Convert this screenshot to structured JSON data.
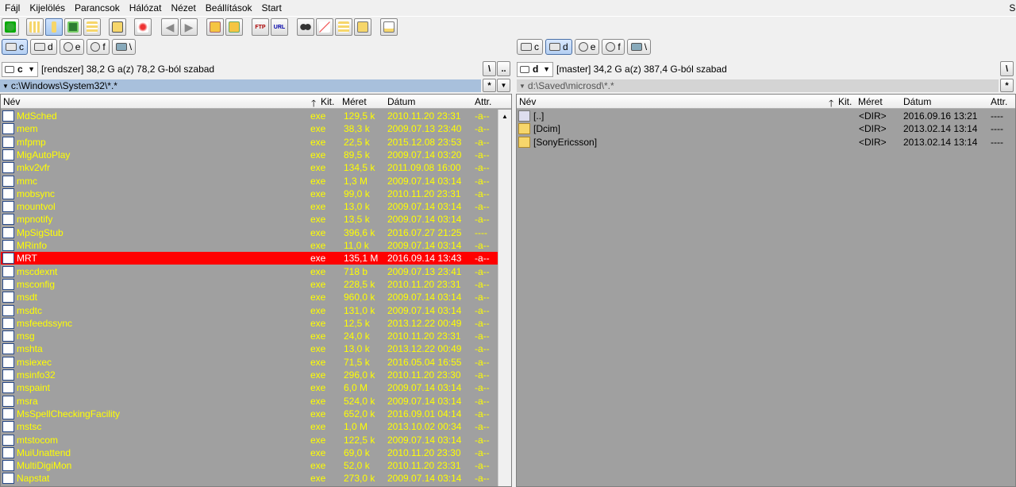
{
  "menu": {
    "items": [
      "Fájl",
      "Kijelölés",
      "Parancsok",
      "Hálózat",
      "Nézet",
      "Beállítások",
      "Start"
    ],
    "overflow": "Sú"
  },
  "toolbar": {
    "buttons": [
      "refresh-icon",
      "brief-view-icon",
      "detailed-view-icon",
      "thumbnails-icon",
      "tree-icon",
      "compare-icon",
      "invert-selection-icon",
      "back-icon",
      "forward-icon",
      "pack-icon",
      "unpack-icon",
      "ftp-icon",
      "url-icon",
      "search-icon",
      "multi-rename-icon",
      "sync-dirs-icon",
      "copy-names-icon",
      "notepad-icon"
    ],
    "ftp_label": "FTP",
    "url_label": "URL"
  },
  "left": {
    "drives": [
      "c",
      "d",
      "e",
      "f",
      "\\"
    ],
    "active_drive": "c",
    "drive_select": "c",
    "info": "[rendszer]  38,2 G a(z) 78,2 G-ból szabad",
    "root_btn": "\\",
    "up_btn": "..",
    "path": "c:\\Windows\\System32\\*.*",
    "star_btn": "*",
    "columns": {
      "name": "Név",
      "ext": "Kit.",
      "size": "Méret",
      "date": "Dátum",
      "attr": "Attr."
    },
    "files": [
      {
        "name": "MdSched",
        "ext": "exe",
        "size": "129,5 k",
        "date": "2010.11.20 23:31",
        "attr": "-a--"
      },
      {
        "name": "mem",
        "ext": "exe",
        "size": "38,3 k",
        "date": "2009.07.13 23:40",
        "attr": "-a--"
      },
      {
        "name": "mfpmp",
        "ext": "exe",
        "size": "22,5 k",
        "date": "2015.12.08 23:53",
        "attr": "-a--"
      },
      {
        "name": "MigAutoPlay",
        "ext": "exe",
        "size": "89,5 k",
        "date": "2009.07.14 03:20",
        "attr": "-a--"
      },
      {
        "name": "mkv2vfr",
        "ext": "exe",
        "size": "134,5 k",
        "date": "2011.09.08 16:00",
        "attr": "-a--"
      },
      {
        "name": "mmc",
        "ext": "exe",
        "size": "1,3 M",
        "date": "2009.07.14 03:14",
        "attr": "-a--"
      },
      {
        "name": "mobsync",
        "ext": "exe",
        "size": "99,0 k",
        "date": "2010.11.20 23:31",
        "attr": "-a--"
      },
      {
        "name": "mountvol",
        "ext": "exe",
        "size": "13,0 k",
        "date": "2009.07.14 03:14",
        "attr": "-a--"
      },
      {
        "name": "mpnotify",
        "ext": "exe",
        "size": "13,5 k",
        "date": "2009.07.14 03:14",
        "attr": "-a--"
      },
      {
        "name": "MpSigStub",
        "ext": "exe",
        "size": "396,6 k",
        "date": "2016.07.27 21:25",
        "attr": "----"
      },
      {
        "name": "MRinfo",
        "ext": "exe",
        "size": "11,0 k",
        "date": "2009.07.14 03:14",
        "attr": "-a--"
      },
      {
        "name": "MRT",
        "ext": "exe",
        "size": "135,1 M",
        "date": "2016.09.14 13:43",
        "attr": "-a--",
        "selected": true
      },
      {
        "name": "mscdexnt",
        "ext": "exe",
        "size": "718 b",
        "date": "2009.07.13 23:41",
        "attr": "-a--"
      },
      {
        "name": "msconfig",
        "ext": "exe",
        "size": "228,5 k",
        "date": "2010.11.20 23:31",
        "attr": "-a--"
      },
      {
        "name": "msdt",
        "ext": "exe",
        "size": "960,0 k",
        "date": "2009.07.14 03:14",
        "attr": "-a--"
      },
      {
        "name": "msdtc",
        "ext": "exe",
        "size": "131,0 k",
        "date": "2009.07.14 03:14",
        "attr": "-a--"
      },
      {
        "name": "msfeedssync",
        "ext": "exe",
        "size": "12,5 k",
        "date": "2013.12.22 00:49",
        "attr": "-a--"
      },
      {
        "name": "msg",
        "ext": "exe",
        "size": "24,0 k",
        "date": "2010.11.20 23:31",
        "attr": "-a--"
      },
      {
        "name": "mshta",
        "ext": "exe",
        "size": "13,0 k",
        "date": "2013.12.22 00:49",
        "attr": "-a--"
      },
      {
        "name": "msiexec",
        "ext": "exe",
        "size": "71,5 k",
        "date": "2016.05.04 16:55",
        "attr": "-a--"
      },
      {
        "name": "msinfo32",
        "ext": "exe",
        "size": "296,0 k",
        "date": "2010.11.20 23:30",
        "attr": "-a--"
      },
      {
        "name": "mspaint",
        "ext": "exe",
        "size": "6,0 M",
        "date": "2009.07.14 03:14",
        "attr": "-a--"
      },
      {
        "name": "msra",
        "ext": "exe",
        "size": "524,0 k",
        "date": "2009.07.14 03:14",
        "attr": "-a--"
      },
      {
        "name": "MsSpellCheckingFacility",
        "ext": "exe",
        "size": "652,0 k",
        "date": "2016.09.01 04:14",
        "attr": "-a--"
      },
      {
        "name": "mstsc",
        "ext": "exe",
        "size": "1,0 M",
        "date": "2013.10.02 00:34",
        "attr": "-a--"
      },
      {
        "name": "mtstocom",
        "ext": "exe",
        "size": "122,5 k",
        "date": "2009.07.14 03:14",
        "attr": "-a--"
      },
      {
        "name": "MuiUnattend",
        "ext": "exe",
        "size": "69,0 k",
        "date": "2010.11.20 23:30",
        "attr": "-a--"
      },
      {
        "name": "MultiDigiMon",
        "ext": "exe",
        "size": "52,0 k",
        "date": "2010.11.20 23:31",
        "attr": "-a--"
      },
      {
        "name": "Napstat",
        "ext": "exe",
        "size": "273,0 k",
        "date": "2009.07.14 03:14",
        "attr": "-a--"
      }
    ]
  },
  "right": {
    "drives": [
      "c",
      "d",
      "e",
      "f",
      "\\"
    ],
    "active_drive": "d",
    "drive_select": "d",
    "info": "[master]  34,2 G a(z) 387,4 G-ból szabad",
    "root_btn": "\\",
    "path": "d:\\Saved\\microsd\\*.*",
    "star_btn": "*",
    "columns": {
      "name": "Név",
      "ext": "Kit.",
      "size": "Méret",
      "date": "Dátum",
      "attr": "Attr."
    },
    "files": [
      {
        "name": "[..]",
        "size": "<DIR>",
        "date": "2016.09.16 13:21",
        "attr": "----",
        "type": "up"
      },
      {
        "name": "[Dcim]",
        "size": "<DIR>",
        "date": "2013.02.14 13:14",
        "attr": "----",
        "type": "folder"
      },
      {
        "name": "[SonyEricsson]",
        "size": "<DIR>",
        "date": "2013.02.14 13:14",
        "attr": "----",
        "type": "folder"
      }
    ]
  },
  "colors": {
    "panel_bg": "#a0a0a0",
    "file_text": "#ffff00",
    "selection": "#ff0000",
    "active_path": "#a8c0dc"
  }
}
